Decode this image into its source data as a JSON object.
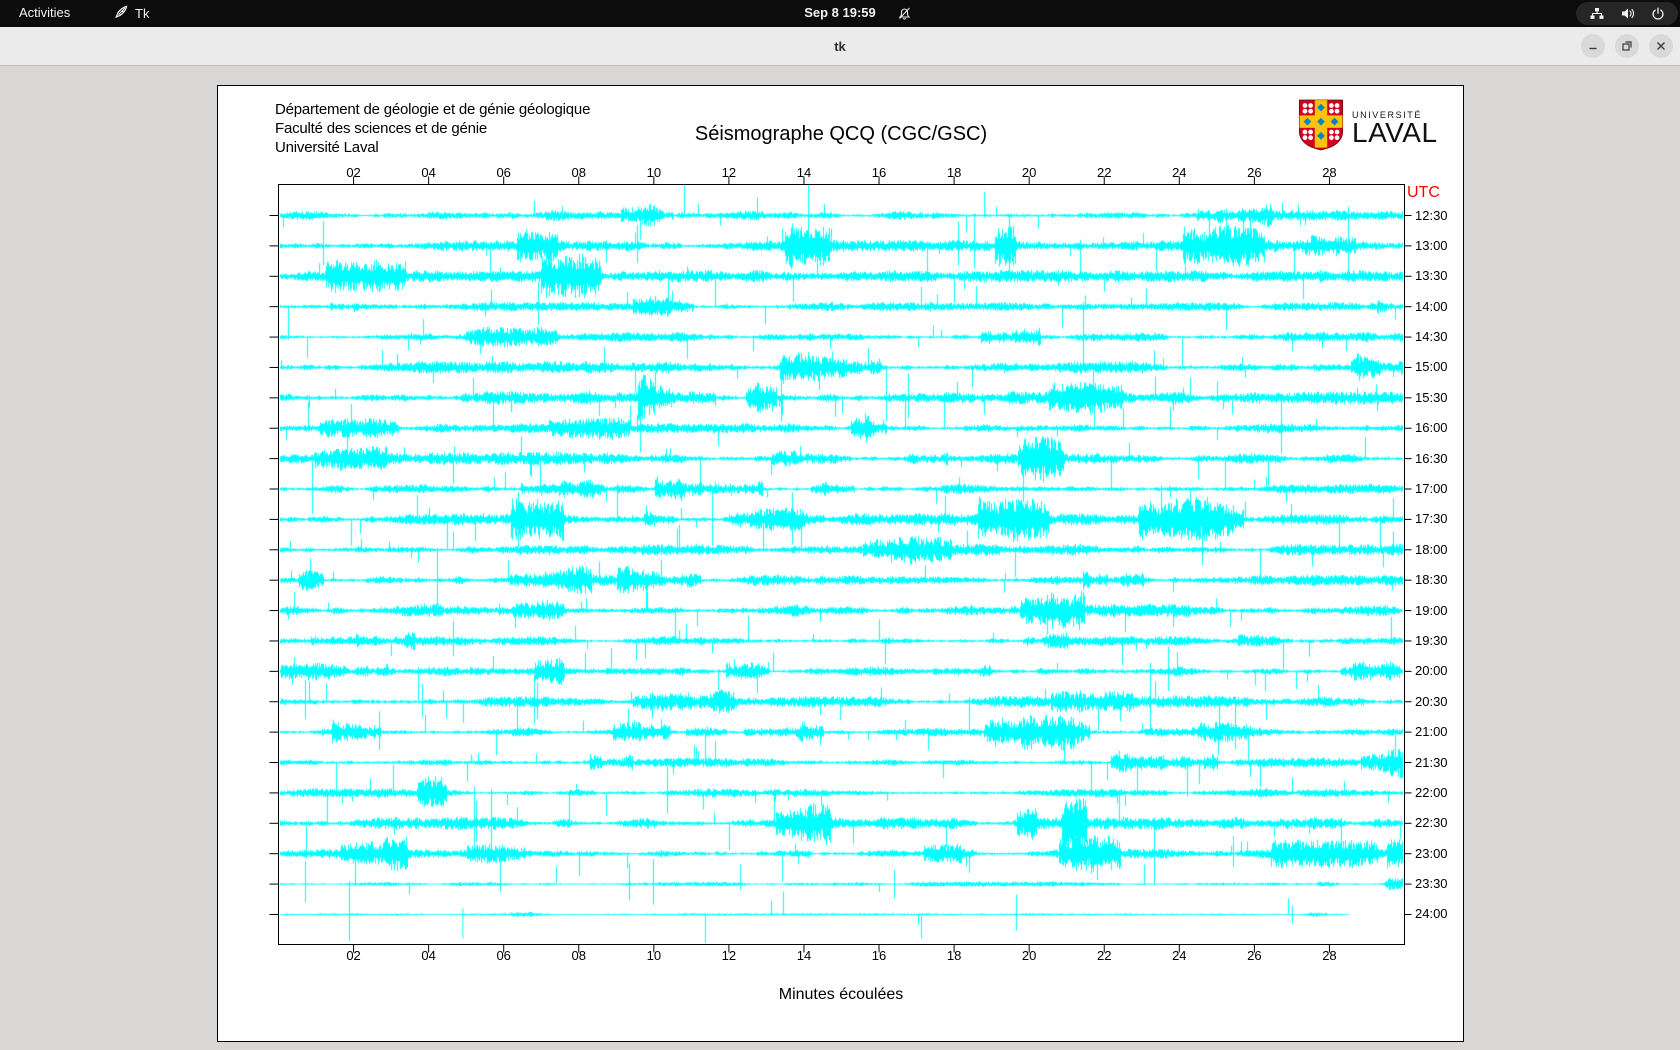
{
  "topbar": {
    "activities_label": "Activities",
    "app_indicator": "Tk",
    "clock": "Sep 8 19:59",
    "icons": {
      "notifications": "bell-slash",
      "network": "wired-network",
      "volume": "speaker",
      "power": "power"
    }
  },
  "titlebar": {
    "title": "tk",
    "buttons": [
      "minimize",
      "restore",
      "close"
    ]
  },
  "figure": {
    "header_lines": [
      "Département de géologie et de génie géologique",
      "Faculté des sciences et de génie",
      "Université Laval"
    ],
    "title": "Séismographe QCQ (CGC/GSC)",
    "logo": {
      "line1": "UNIVERSITÉ",
      "line2": "LAVAL"
    },
    "utc_label": "UTC",
    "xlabel": "Minutes écoulées"
  },
  "chart_data": {
    "type": "line",
    "subtype": "helicorder-seismogram",
    "title": "Séismographe QCQ (CGC/GSC)",
    "xlabel": "Minutes écoulées",
    "x_range_minutes": [
      0,
      30
    ],
    "x_ticks": [
      "02",
      "04",
      "06",
      "08",
      "10",
      "12",
      "14",
      "16",
      "18",
      "20",
      "22",
      "24",
      "26",
      "28"
    ],
    "row_labels": [
      "12:30",
      "13:00",
      "13:30",
      "14:00",
      "14:30",
      "15:00",
      "15:30",
      "16:00",
      "16:30",
      "17:00",
      "17:30",
      "18:00",
      "18:30",
      "19:00",
      "19:30",
      "20:00",
      "20:30",
      "21:00",
      "21:30",
      "22:00",
      "22:30",
      "23:00",
      "23:30",
      "24:00"
    ],
    "rows": 24,
    "trace_color": "#00ffff",
    "quiet_rows": [
      "23:30",
      "24:00"
    ],
    "last_row_end_minute": 28.5,
    "seed": 20250908
  }
}
